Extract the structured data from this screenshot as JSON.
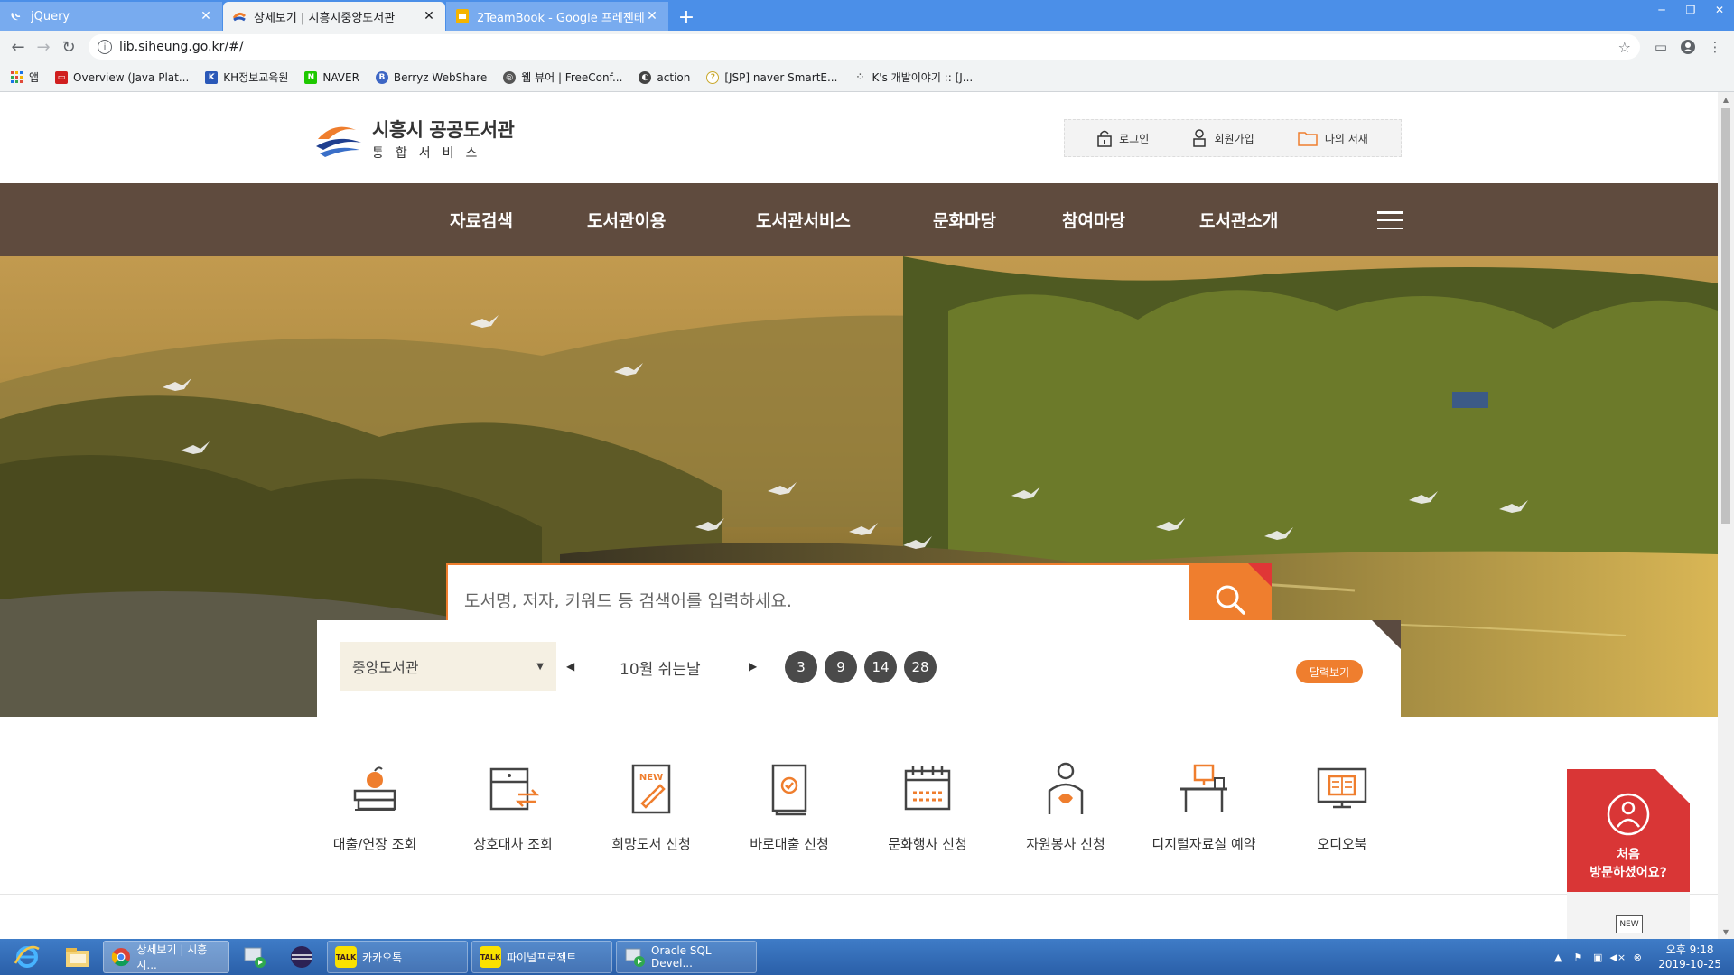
{
  "browser": {
    "tabs": [
      {
        "title": "jQuery",
        "active": false
      },
      {
        "title": "상세보기 | 시흥시중앙도서관",
        "active": true
      },
      {
        "title": "2TeamBook - Google 프레젠테이",
        "active": false
      }
    ],
    "new_tab": "+",
    "url": "lib.siheung.go.kr/#/",
    "bookmarks": [
      {
        "label": "앱",
        "color": "#e04a3a"
      },
      {
        "label": "Overview (Java Plat...",
        "color": "#d01e1e"
      },
      {
        "label": "KH정보교육원",
        "color": "#2a58b8"
      },
      {
        "label": "NAVER",
        "color": "#1ec800"
      },
      {
        "label": "Berryz WebShare",
        "color": "#3d66c4"
      },
      {
        "label": "웹 뷰어 | FreeConf...",
        "color": "#555555"
      },
      {
        "label": "action",
        "color": "#444444"
      },
      {
        "label": "[JSP] naver SmartE...",
        "color": "#c9a82c"
      },
      {
        "label": "K's 개발이야기 :: [J...",
        "color": "#333333"
      }
    ]
  },
  "site": {
    "logo": {
      "title": "시흥시 공공도서관",
      "subtitle": "통합서비스"
    },
    "util": [
      "로그인",
      "회원가입",
      "나의 서재"
    ],
    "nav": [
      "자료검색",
      "도서관이용",
      "도서관서비스",
      "문화마당",
      "참여마당",
      "도서관소개"
    ],
    "search": {
      "placeholder": "도서명, 저자, 키워드 등 검색어를 입력하세요."
    },
    "calendar": {
      "library": "중앙도서관",
      "title": "10월 쉬는날",
      "days": [
        "3",
        "9",
        "14",
        "28"
      ],
      "button": "달력보기"
    },
    "quick_links": [
      "대출/연장 조회",
      "상호대차 조회",
      "희망도서 신청",
      "바로대출 신청",
      "문화행사 신청",
      "자원봉사 신청",
      "디지털자료실 예약",
      "오디오북"
    ],
    "first_visit": {
      "line1": "처음",
      "line2": "방문하셨어요?"
    },
    "new_badge": "NEW"
  },
  "taskbar": {
    "apps": [
      {
        "label": "상세보기 | 시흥시...",
        "icon": "chrome-icon",
        "active": true
      },
      {
        "label": "카카오톡",
        "icon": "kakaotalk-icon",
        "active": false
      },
      {
        "label": "파이널프로젝트",
        "icon": "kakaotalk-icon",
        "active": false
      },
      {
        "label": "Oracle SQL Devel...",
        "icon": "sql-developer-icon",
        "active": false
      }
    ],
    "clock": {
      "time": "오후 9:18",
      "date": "2019-10-25"
    }
  },
  "colors": {
    "accent": "#ef7e2e",
    "nav_bg": "#5f4b3e",
    "promo_red": "#d93636"
  }
}
